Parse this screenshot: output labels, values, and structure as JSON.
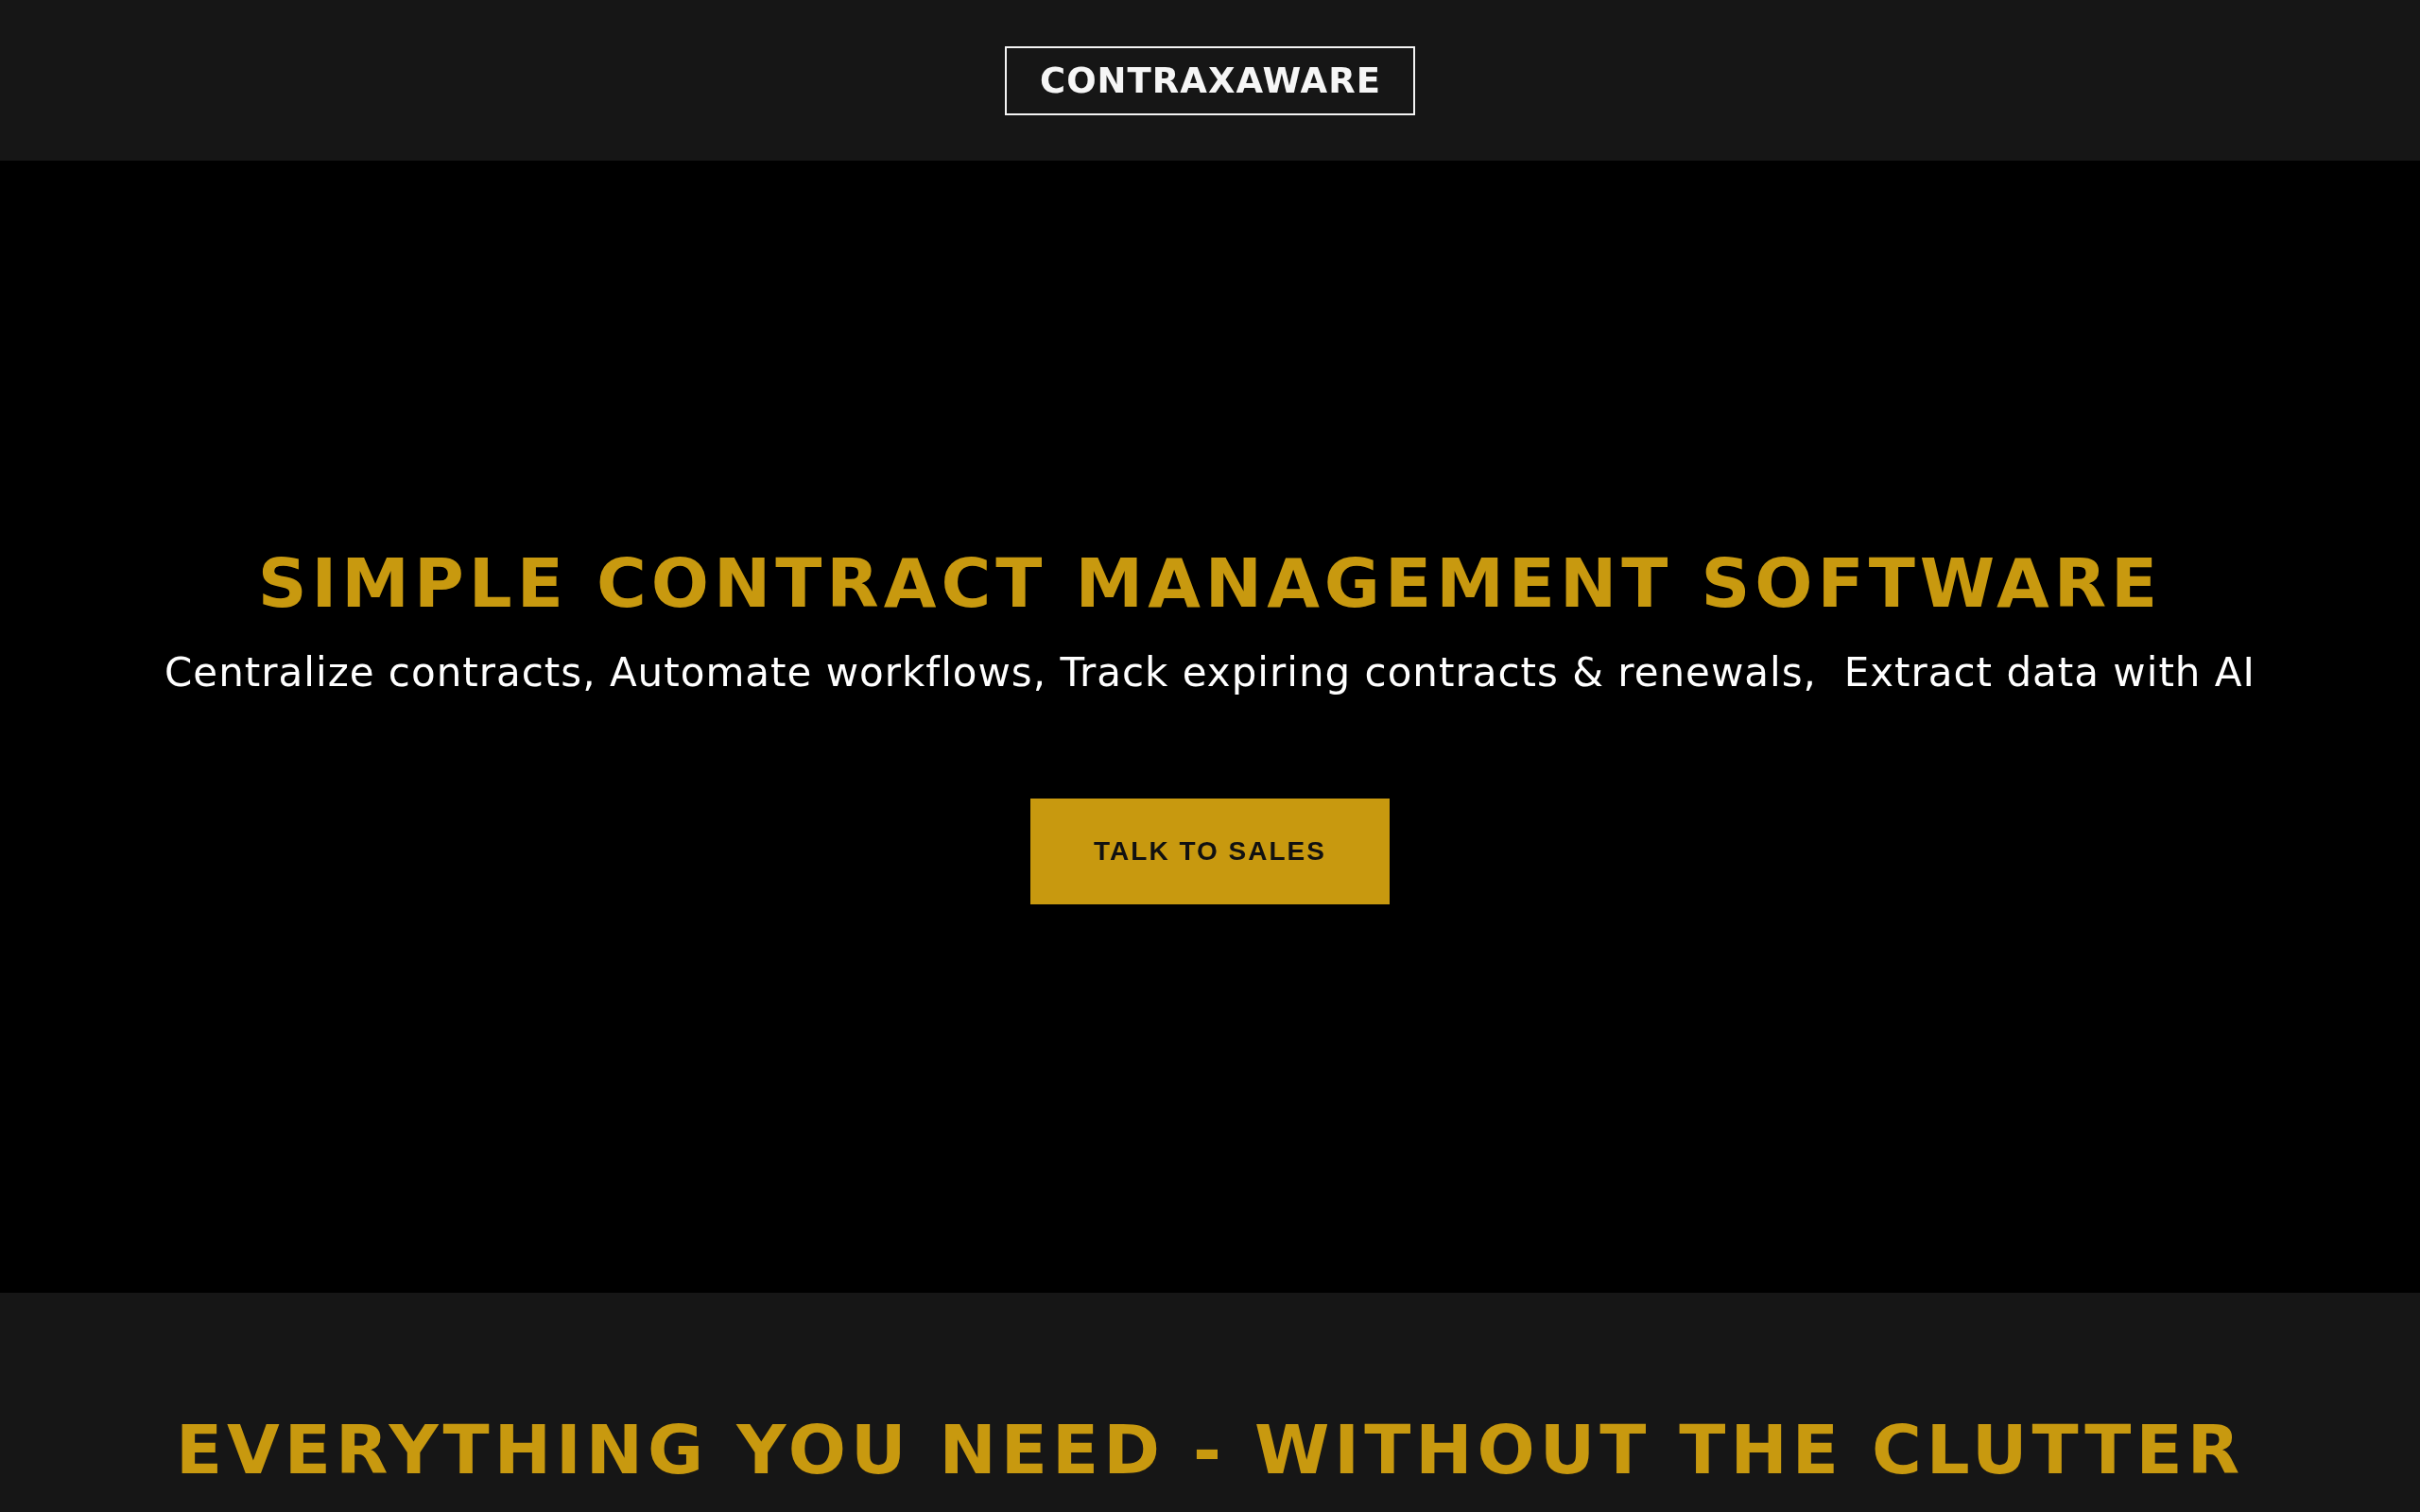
{
  "header": {
    "logo": "CONTRAXAWARE"
  },
  "hero": {
    "title": "SIMPLE CONTRACT MANAGEMENT SOFTWARE",
    "subtitle": "Centralize contracts, Automate workflows, Track expiring contracts & renewals,  Extract data with AI",
    "button": "TALK TO SALES"
  },
  "features": {
    "title": "EVERYTHING YOU NEED - WITHOUT THE CLUTTER"
  }
}
